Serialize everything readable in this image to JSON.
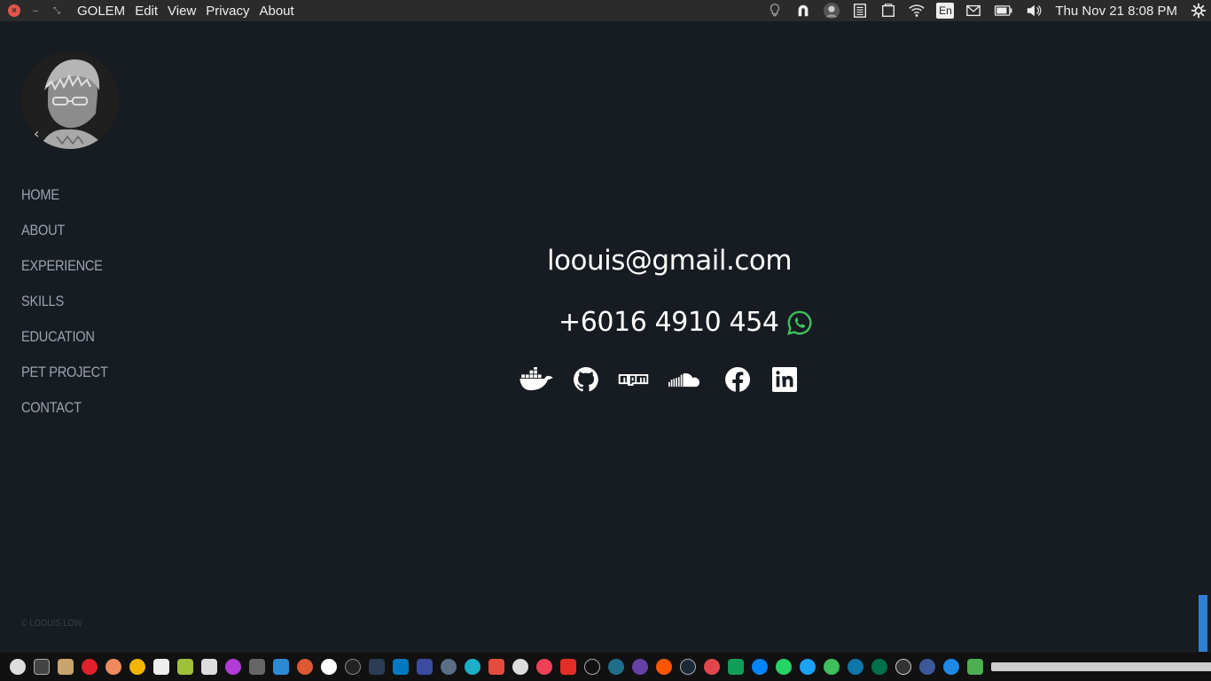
{
  "topbar": {
    "app_name": "GOLEM",
    "menus": [
      "Edit",
      "View",
      "Privacy",
      "About"
    ],
    "language": "En",
    "clock": "Thu Nov 21  8:08 PM"
  },
  "sidebar": {
    "items": [
      {
        "label": "HOME"
      },
      {
        "label": "ABOUT"
      },
      {
        "label": "EXPERIENCE"
      },
      {
        "label": "SKILLS"
      },
      {
        "label": "EDUCATION"
      },
      {
        "label": "PET PROJECT"
      },
      {
        "label": "CONTACT"
      }
    ],
    "copyright": "© LOOUIS LOW"
  },
  "contact": {
    "email": "loouis@gmail.com",
    "phone": "+6016 4910 454"
  },
  "socials": [
    "docker-icon",
    "github-icon",
    "npm-icon",
    "soundcloud-icon",
    "facebook-icon",
    "linkedin-icon"
  ],
  "colors": {
    "background": "#171b22",
    "whatsapp": "#3fbf5e",
    "nav_text": "#9aa3ad",
    "scroll_thumb": "#2f7fd4"
  }
}
